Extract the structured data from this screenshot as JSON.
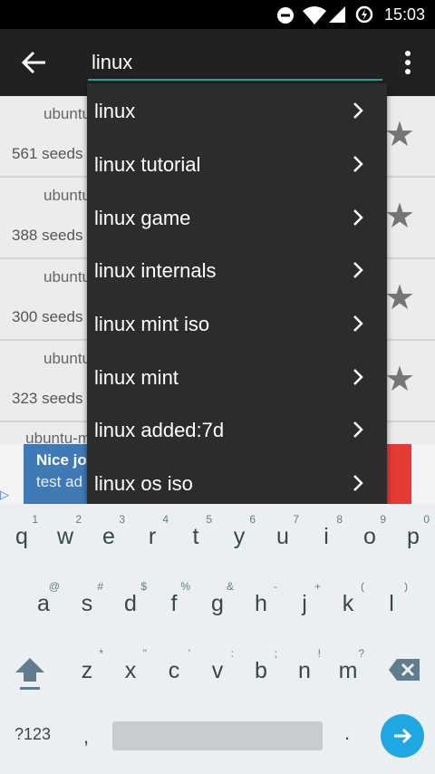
{
  "status_bar": {
    "time": "15:03"
  },
  "toolbar": {
    "query": "linux"
  },
  "results": [
    {
      "name": "ubuntu",
      "seeds": "561 seeds"
    },
    {
      "name": "ubuntu",
      "seeds": "388 seeds"
    },
    {
      "name": "ubuntu",
      "seeds": "300 seeds"
    },
    {
      "name": "ubuntu",
      "seeds": "323 seeds"
    },
    {
      "name": "ubuntu-m",
      "seeds": ""
    }
  ],
  "ad": {
    "title": "Nice jo",
    "desc": "test ad",
    "choices": "▷"
  },
  "suggestions": [
    "linux",
    "linux tutorial",
    "linux game",
    "linux internals",
    "linux mint iso",
    "linux mint",
    "linux added:7d",
    "linux os iso"
  ],
  "keyboard": {
    "row1": [
      {
        "k": "q",
        "h": "1"
      },
      {
        "k": "w",
        "h": "2"
      },
      {
        "k": "e",
        "h": "3"
      },
      {
        "k": "r",
        "h": "4"
      },
      {
        "k": "t",
        "h": "5"
      },
      {
        "k": "y",
        "h": "6"
      },
      {
        "k": "u",
        "h": "7"
      },
      {
        "k": "i",
        "h": "8"
      },
      {
        "k": "o",
        "h": "9"
      },
      {
        "k": "p",
        "h": "0"
      }
    ],
    "row2": [
      {
        "k": "a",
        "h": "@"
      },
      {
        "k": "s",
        "h": "#"
      },
      {
        "k": "d",
        "h": "$"
      },
      {
        "k": "f",
        "h": "%"
      },
      {
        "k": "g",
        "h": "&"
      },
      {
        "k": "h",
        "h": "-"
      },
      {
        "k": "j",
        "h": "+"
      },
      {
        "k": "k",
        "h": "("
      },
      {
        "k": "l",
        "h": ")"
      }
    ],
    "row3": [
      {
        "k": "z",
        "h": "*"
      },
      {
        "k": "x",
        "h": "\""
      },
      {
        "k": "c",
        "h": "'"
      },
      {
        "k": "v",
        "h": ":"
      },
      {
        "k": "b",
        "h": ";"
      },
      {
        "k": "n",
        "h": "!"
      },
      {
        "k": "m",
        "h": "?"
      }
    ],
    "symbols_label": "?123",
    "comma": ",",
    "period": "."
  },
  "colors": {
    "accent": "#26a69a",
    "enter": "#1ea7e1",
    "toolbar": "#212121",
    "dropdown": "#2c2c2c"
  }
}
